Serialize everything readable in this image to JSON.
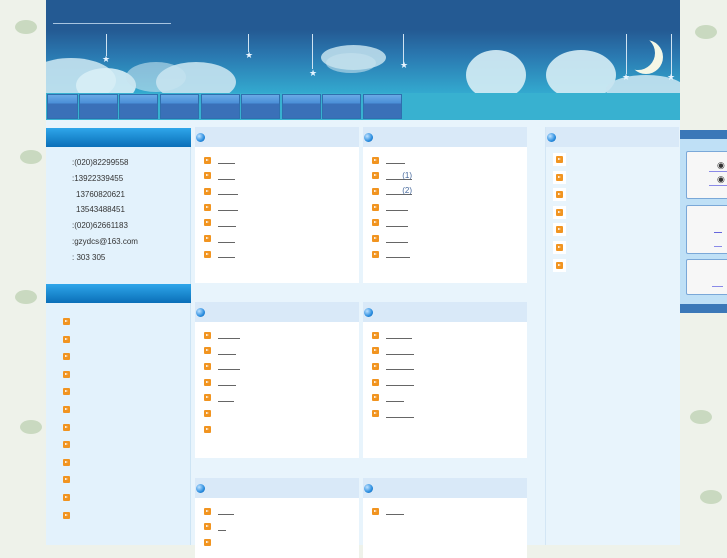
{
  "header": {
    "title": ""
  },
  "nav": {
    "items": [
      "",
      "",
      "",
      "",
      "",
      "",
      "",
      "",
      ""
    ]
  },
  "contact": {
    "lines": [
      ":(020)82299558",
      ":13922339455",
      "13760820621",
      "13543488451",
      ":(020)62661183",
      ":gzydcs@163.com",
      ":     303   305"
    ]
  },
  "left_list": {
    "count": 12
  },
  "panels": [
    {
      "links": [
        "",
        "",
        "",
        "",
        "",
        "",
        ""
      ]
    },
    {
      "links": [
        "",
        "(1)",
        "(2)",
        "",
        "",
        "",
        ""
      ]
    },
    {
      "links": [
        "",
        "",
        "",
        "",
        "",
        "",
        ""
      ]
    },
    {
      "links": [
        "",
        "",
        "",
        "",
        "",
        ""
      ]
    },
    {
      "links": [
        "",
        "",
        ""
      ]
    },
    {
      "links": [
        ""
      ]
    }
  ],
  "right_list": {
    "count": 7
  },
  "colors": {
    "accent": "#0a6fb8",
    "bullet": "#f19420",
    "panel_header": "#d9e9f8"
  }
}
